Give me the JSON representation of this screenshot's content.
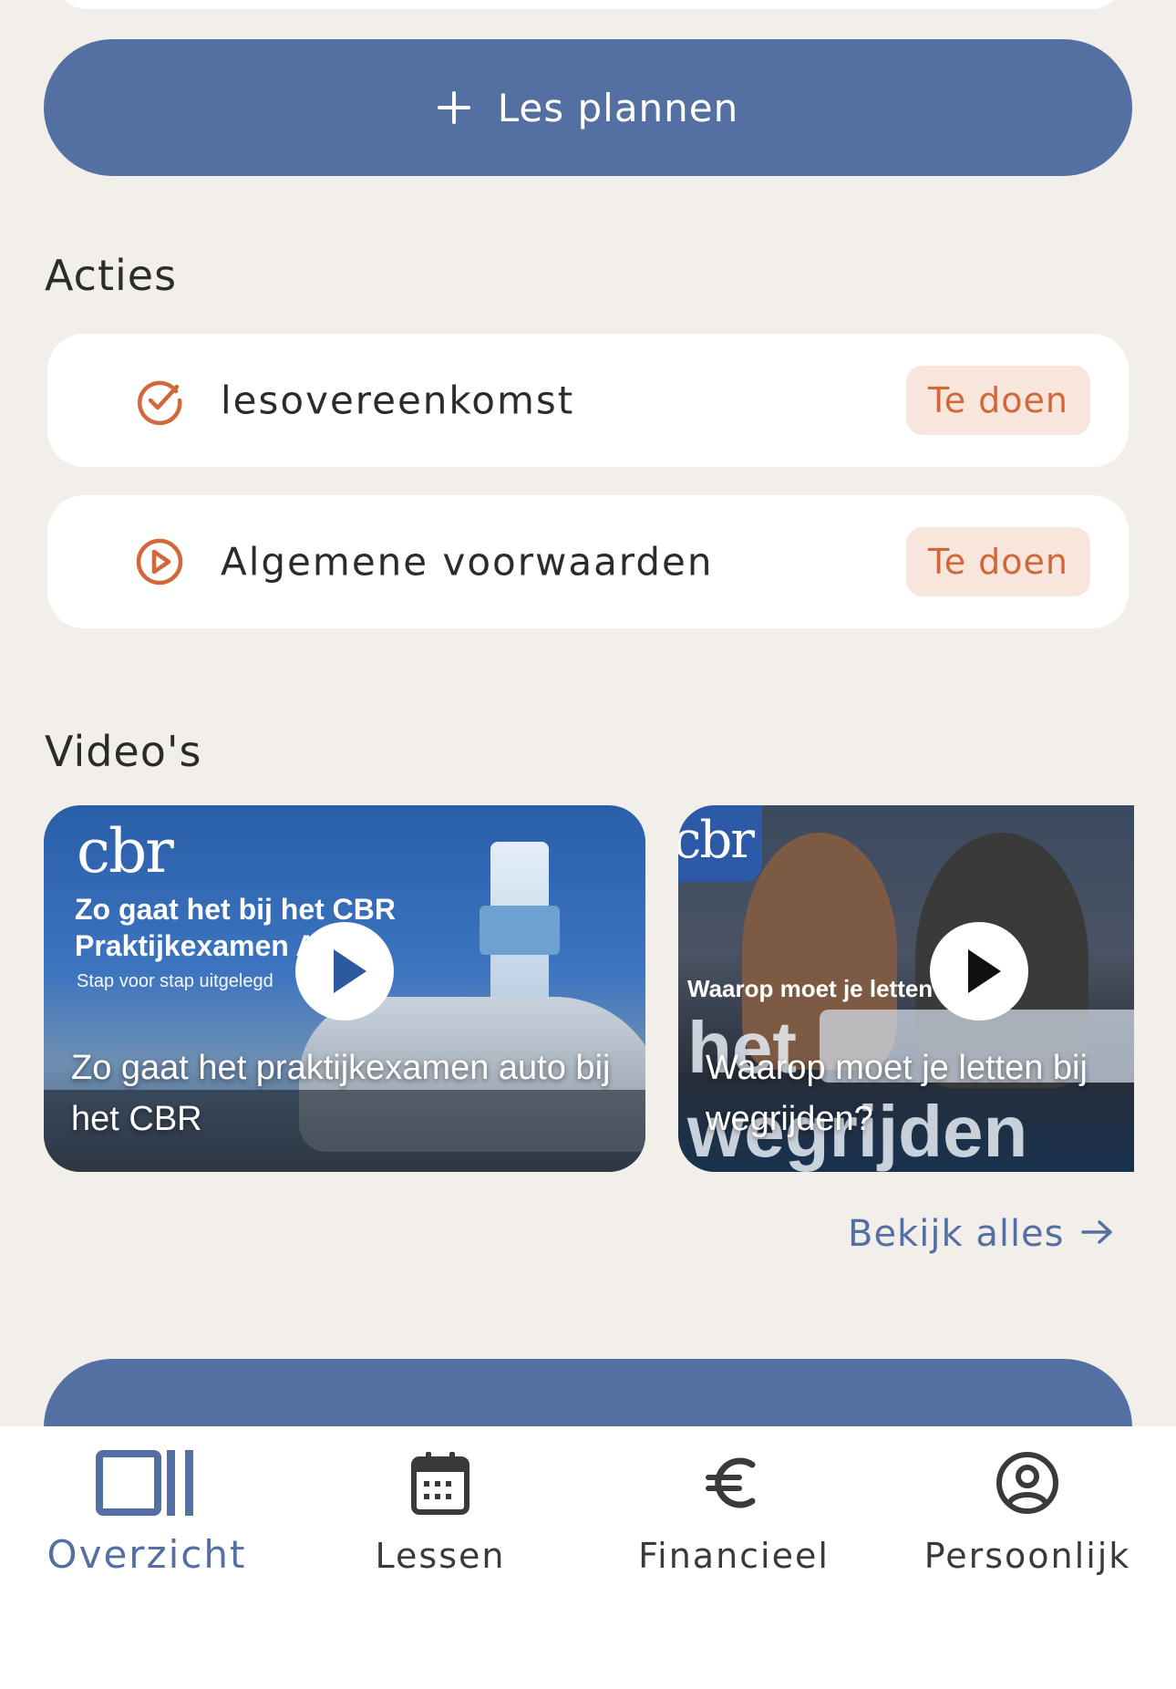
{
  "plan_button": {
    "label": "Les plannen",
    "icon": "plus-icon"
  },
  "actions": {
    "title": "Acties",
    "items": [
      {
        "label": "lesovereenkomst",
        "badge": "Te doen",
        "icon": "check-circle-icon"
      },
      {
        "label": "Algemene voorwaarden",
        "badge": "Te doen",
        "icon": "play-circle-icon"
      }
    ]
  },
  "videos": {
    "title": "Video's",
    "items": [
      {
        "caption": "Zo gaat het praktijkexamen auto bij het CBR",
        "thumb_logo": "cbr",
        "thumb_headline": "Zo gaat het bij het CBR Praktijkexamen Auto",
        "thumb_subline": "Stap voor stap uitgelegd"
      },
      {
        "caption": "Waarop moet je letten bij wegrijden?",
        "thumb_logo": "cbr",
        "thumb_headline": "Waarop moet je letten bij",
        "thumb_big_word": "het wegrijden"
      }
    ],
    "see_all": "Bekijk alles",
    "see_all_icon": "arrow-right-icon"
  },
  "colors": {
    "primary": "#5470a3",
    "accent": "#d2683a",
    "background": "#f2efea"
  },
  "nav": {
    "items": [
      {
        "label": "Overzicht",
        "icon": "dashboard-icon",
        "active": true
      },
      {
        "label": "Lessen",
        "icon": "calendar-icon",
        "active": false
      },
      {
        "label": "Financieel",
        "icon": "euro-icon",
        "active": false
      },
      {
        "label": "Persoonlijk",
        "icon": "user-circle-icon",
        "active": false
      }
    ]
  }
}
